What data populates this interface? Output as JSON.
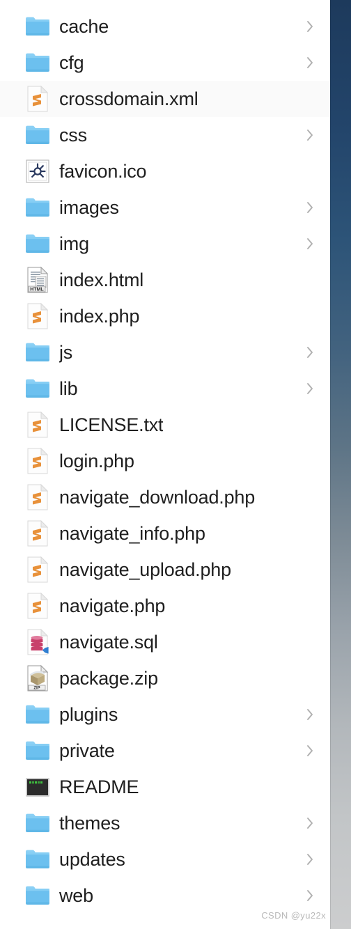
{
  "window": {
    "kind": "file-browser-list",
    "background_color": "#ffffff",
    "text_color": "#1f1f1f",
    "chevron_color": "#b0b0b0",
    "folder_color": "#6cc0ef",
    "folder_tab_color": "#8bd0f5",
    "accent_sublime_color": "#e8913a",
    "accent_sql_color": "#c8416b",
    "accent_terminal_color": "#2b2b2b",
    "accent_terminal_text_color": "#3ec13e"
  },
  "wallpaper": {
    "top_color": "#1d3a5c",
    "bottom_color": "#cccdce"
  },
  "watermark": {
    "text": "CSDN @yu22x"
  },
  "file_list": {
    "item_count": 25,
    "items": [
      {
        "name": "cache",
        "icon": "folder-icon",
        "type": "folder",
        "has_chevron": true
      },
      {
        "name": "cfg",
        "icon": "folder-icon",
        "type": "folder",
        "has_chevron": true
      },
      {
        "name": "crossdomain.xml",
        "icon": "sublime-file-icon",
        "type": "file",
        "has_chevron": false
      },
      {
        "name": "css",
        "icon": "folder-icon",
        "type": "folder",
        "has_chevron": true
      },
      {
        "name": "favicon.ico",
        "icon": "favicon-image-icon",
        "type": "file",
        "has_chevron": false
      },
      {
        "name": "images",
        "icon": "folder-icon",
        "type": "folder",
        "has_chevron": true
      },
      {
        "name": "img",
        "icon": "folder-icon",
        "type": "folder",
        "has_chevron": true
      },
      {
        "name": "index.html",
        "icon": "html-file-icon",
        "type": "file",
        "has_chevron": false
      },
      {
        "name": "index.php",
        "icon": "sublime-file-icon",
        "type": "file",
        "has_chevron": false
      },
      {
        "name": "js",
        "icon": "folder-icon",
        "type": "folder",
        "has_chevron": true
      },
      {
        "name": "lib",
        "icon": "folder-icon",
        "type": "folder",
        "has_chevron": true
      },
      {
        "name": "LICENSE.txt",
        "icon": "sublime-file-icon",
        "type": "file",
        "has_chevron": false
      },
      {
        "name": "login.php",
        "icon": "sublime-file-icon",
        "type": "file",
        "has_chevron": false
      },
      {
        "name": "navigate_download.php",
        "icon": "sublime-file-icon",
        "type": "file",
        "has_chevron": false
      },
      {
        "name": "navigate_info.php",
        "icon": "sublime-file-icon",
        "type": "file",
        "has_chevron": false
      },
      {
        "name": "navigate_upload.php",
        "icon": "sublime-file-icon",
        "type": "file",
        "has_chevron": false
      },
      {
        "name": "navigate.php",
        "icon": "sublime-file-icon",
        "type": "file",
        "has_chevron": false
      },
      {
        "name": "navigate.sql",
        "icon": "sql-file-icon",
        "type": "file",
        "has_chevron": false
      },
      {
        "name": "package.zip",
        "icon": "zip-archive-icon",
        "type": "file",
        "has_chevron": false
      },
      {
        "name": "plugins",
        "icon": "folder-icon",
        "type": "folder",
        "has_chevron": true
      },
      {
        "name": "private",
        "icon": "folder-icon",
        "type": "folder",
        "has_chevron": true
      },
      {
        "name": "README",
        "icon": "terminal-file-icon",
        "type": "file",
        "has_chevron": false
      },
      {
        "name": "themes",
        "icon": "folder-icon",
        "type": "folder",
        "has_chevron": true
      },
      {
        "name": "updates",
        "icon": "folder-icon",
        "type": "folder",
        "has_chevron": true
      },
      {
        "name": "web",
        "icon": "folder-icon",
        "type": "folder",
        "has_chevron": true
      }
    ]
  }
}
